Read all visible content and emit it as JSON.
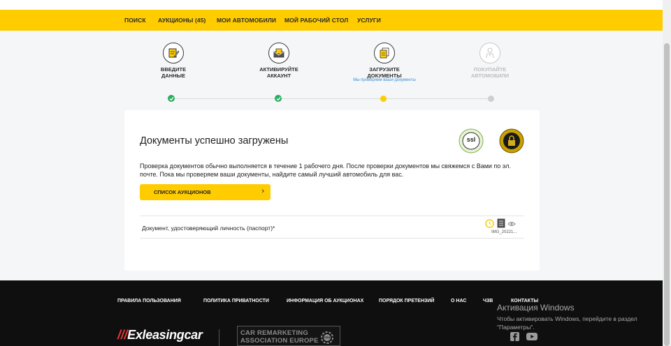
{
  "nav": {
    "items": [
      "ПОИСК",
      "АУКЦИОНЫ (45)",
      "МОИ АВТОМОБИЛИ",
      "МОЙ РАБОЧИЙ СТОЛ",
      "УСЛУГИ"
    ]
  },
  "steps": [
    {
      "line1": "ВВЕДИТЕ",
      "line2": "ДАННЫЕ",
      "status": "done"
    },
    {
      "line1": "АКТИВИРУЙТЕ",
      "line2": "АККАУНТ",
      "status": "done"
    },
    {
      "line1": "ЗАГРУЗИТЕ",
      "line2": "ДОКУМЕНТЫ",
      "sub": "Мы проверяем ваши документы",
      "status": "current"
    },
    {
      "line1": "ПОКУПАЙТЕ",
      "line2": "АВТОМОБИЛИ",
      "status": "pending"
    }
  ],
  "card": {
    "title": "Документы успешно загружены",
    "text": "Проверка документов обычно выполняется в течение 1 рабочего дня. После проверки документов мы свяжемся с Вами по эл. почте. Пока мы проверяем ваши документы, найдите самый лучший автомобиль для вас.",
    "button_label": "СПИСОК АУКЦИОНОВ",
    "badge_ssl": "ssl"
  },
  "document_row": {
    "label": "Документ, удостоверяющий личность (паспорт)*",
    "file_name": "IMG_20221..."
  },
  "footer": {
    "links": [
      "ПРАВИЛА ПОЛЬЗОВАНИЯ",
      "ПОЛИТИКА ПРИВАТНОСТИ",
      "ИНФОРМАЦИЯ ОБ АУКЦИОНАХ",
      "ПОРЯДОК ПРЕТЕНЗИЙ",
      "О НАС",
      "ЧЗВ",
      "КОНТАКТЫ"
    ],
    "logo_text": "Exleasingcar",
    "cra_line1": "CAR REMARKETING",
    "cra_line2": "ASSOCIATION EUROPE",
    "cra_badge": "CRA"
  },
  "windows_watermark": {
    "title": "Активация Windows",
    "text": "Чтобы активировать Windows, перейдите в раздел \"Параметры\"."
  },
  "colors": {
    "accent": "#ffcc00",
    "done": "#27ae60",
    "pending": "#cfcfcf",
    "footer_bg": "#0f0f0f",
    "link_blue": "#3b8fd1"
  }
}
